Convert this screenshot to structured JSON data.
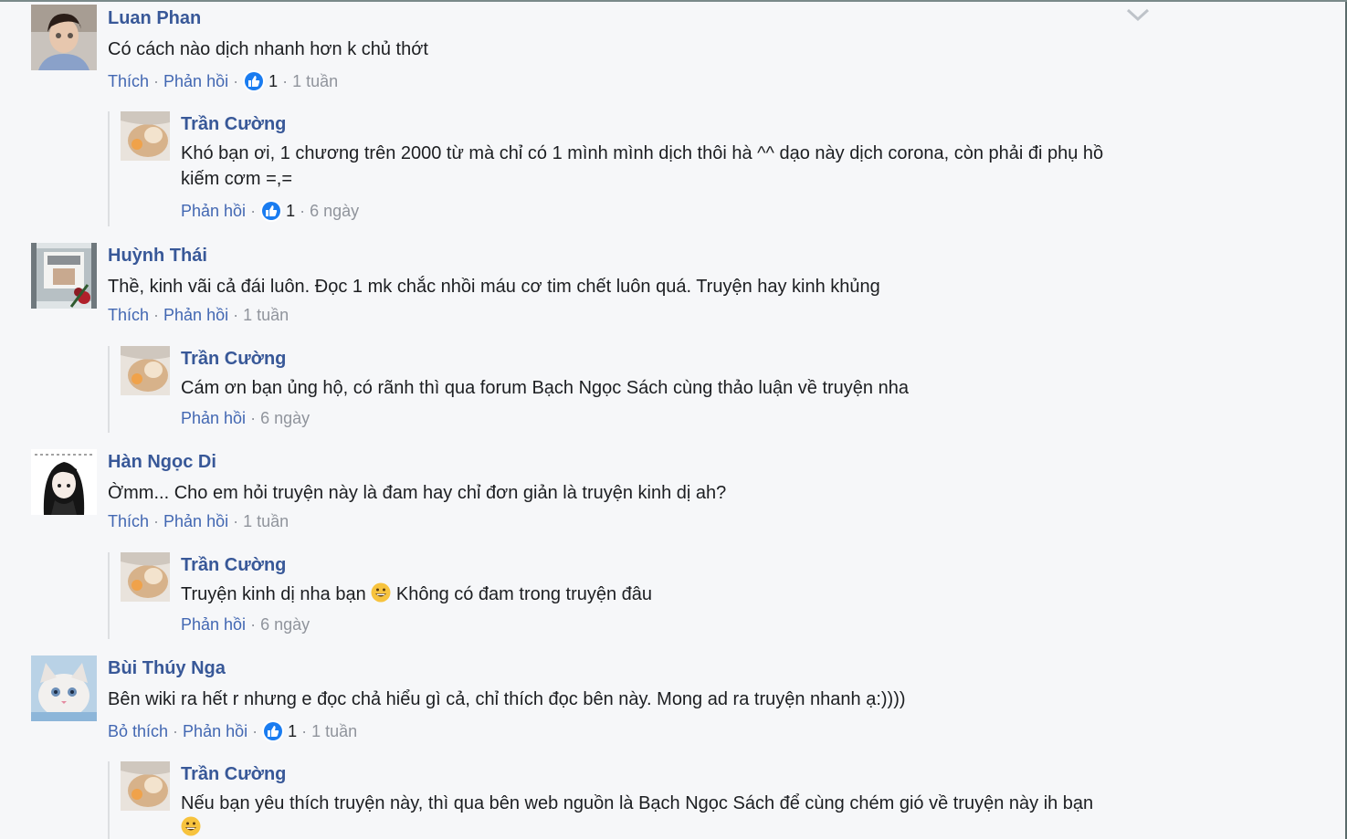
{
  "comments": [
    {
      "author": "Luan Phan",
      "text": "Có cách nào dịch nhanh hơn k chủ thớt",
      "like_label": "Thích",
      "reply_label": "Phản hồi",
      "reactions": "1",
      "time": "1 tuần",
      "reply": {
        "author": "Trần Cường",
        "text": "Khó bạn ơi, 1 chương trên 2000 từ mà chỉ có 1 mình mình dịch thôi hà ^^ dạo này dịch corona, còn phải đi phụ hồ kiếm cơm =,=",
        "reply_label": "Phản hồi",
        "reactions": "1",
        "time": "6 ngày"
      }
    },
    {
      "author": "Huỳnh Thái",
      "text": "Thề, kinh vãi cả đái luôn. Đọc 1 mk chắc nhồi máu cơ tim chết luôn quá. Truyện hay kinh khủng",
      "like_label": "Thích",
      "reply_label": "Phản hồi",
      "time": "1 tuần",
      "reply": {
        "author": "Trần Cường",
        "text": "Cám ơn bạn ủng hộ, có rãnh thì qua forum Bạch Ngọc Sách cùng thảo luận về truyện nha",
        "reply_label": "Phản hồi",
        "time": "6 ngày"
      }
    },
    {
      "author": "Hàn Ngọc Di",
      "text": "Ờmm... Cho em hỏi truyện này là đam hay chỉ đơn giản là truyện kinh dị ah?",
      "like_label": "Thích",
      "reply_label": "Phản hồi",
      "time": "1 tuần",
      "reply": {
        "author": "Trần Cường",
        "text_before": "Truyện kinh dị nha bạn",
        "text_after": "Không có đam trong truyện đâu",
        "reply_label": "Phản hồi",
        "time": "6 ngày"
      }
    },
    {
      "author": "Bùi Thúy Nga",
      "text": "Bên wiki ra hết r nhưng e đọc chả hiểu gì cả, chỉ thích đọc bên này. Mong ad ra truyện nhanh ạ:))))",
      "like_label": "Bỏ thích",
      "reply_label": "Phản hồi",
      "reactions": "1",
      "time": "1 tuần",
      "reply": {
        "author": "Trần Cường",
        "text": "Nếu bạn yêu thích truyện này, thì qua bên web nguồn là Bạch Ngọc Sách để cùng chém gió về truyện này ih bạn"
      }
    }
  ],
  "colors": {
    "link": "#385898",
    "action": "#4267b2",
    "muted": "#90949c",
    "like": "#1a7cf0",
    "background": "#f6f7f9"
  },
  "icons": {
    "reaction": "like-thumb-icon",
    "menu": "chevron-down-icon",
    "smile": "grinning-emoji"
  }
}
